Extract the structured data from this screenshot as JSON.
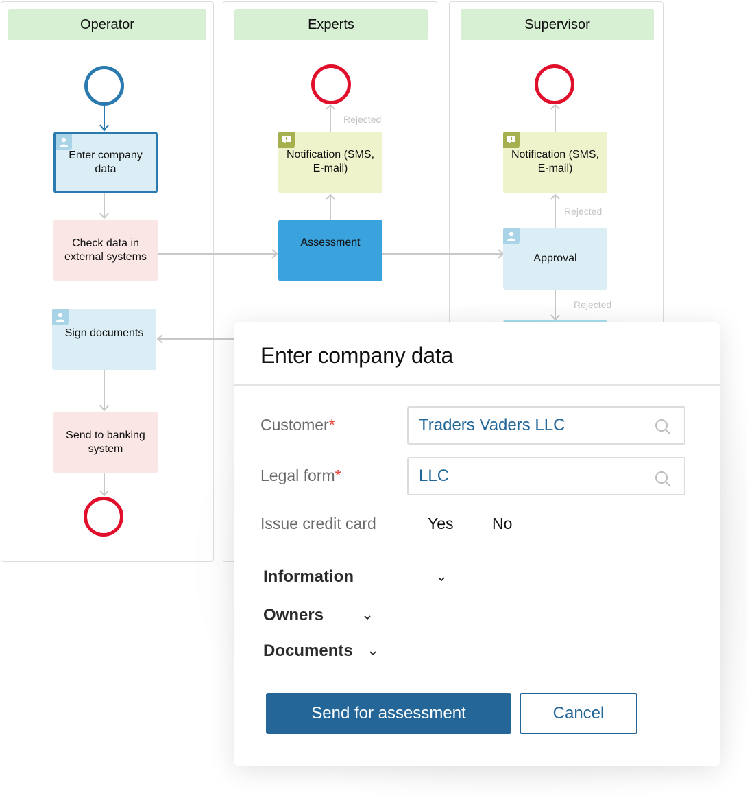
{
  "lanes": [
    {
      "name": "Operator"
    },
    {
      "name": "Experts"
    },
    {
      "name": "Supervisor"
    }
  ],
  "nodes": {
    "enter_company_data": "Enter company data",
    "check_data": "Check data in external systems",
    "sign_documents": "Sign documents",
    "send_to_banking": "Send to banking system",
    "experts_notification": "Notification (SMS, E-mail)",
    "assessment": "Assessment",
    "supervisor_notification": "Notification (SMS, E-mail)",
    "approval": "Approval"
  },
  "flow_labels": {
    "experts_rejected": "Rejected",
    "supervisor_rejected_up": "Rejected",
    "supervisor_rejected_down": "Rejected"
  },
  "icons": {
    "user_task": "user-icon",
    "notification_task": "message-alert-icon",
    "lookup": "search-icon",
    "expand": "chevron-down-icon"
  },
  "colors": {
    "lane_header": "#d7efd2",
    "user_task": "#dbedf5",
    "service_task": "#fbe6e6",
    "notify_task": "#eef3cc",
    "assessment_task": "#3aa3dd",
    "start_event": "#2a7aaf",
    "end_event": "#e00f2c",
    "primary": "#236697",
    "required": "#e33b2e"
  },
  "form": {
    "title": "Enter company data",
    "fields": [
      {
        "label": "Customer",
        "required_mark": "*",
        "value": "Traders Vaders LLC"
      },
      {
        "label": "Legal form",
        "required_mark": "*",
        "value": "LLC"
      }
    ],
    "credit_card": {
      "label": "Issue credit card",
      "options": [
        "Yes",
        "No"
      ]
    },
    "sections": [
      "Information",
      "Owners",
      "Documents"
    ],
    "submit_label": "Send for assessment",
    "cancel_label": "Cancel"
  }
}
